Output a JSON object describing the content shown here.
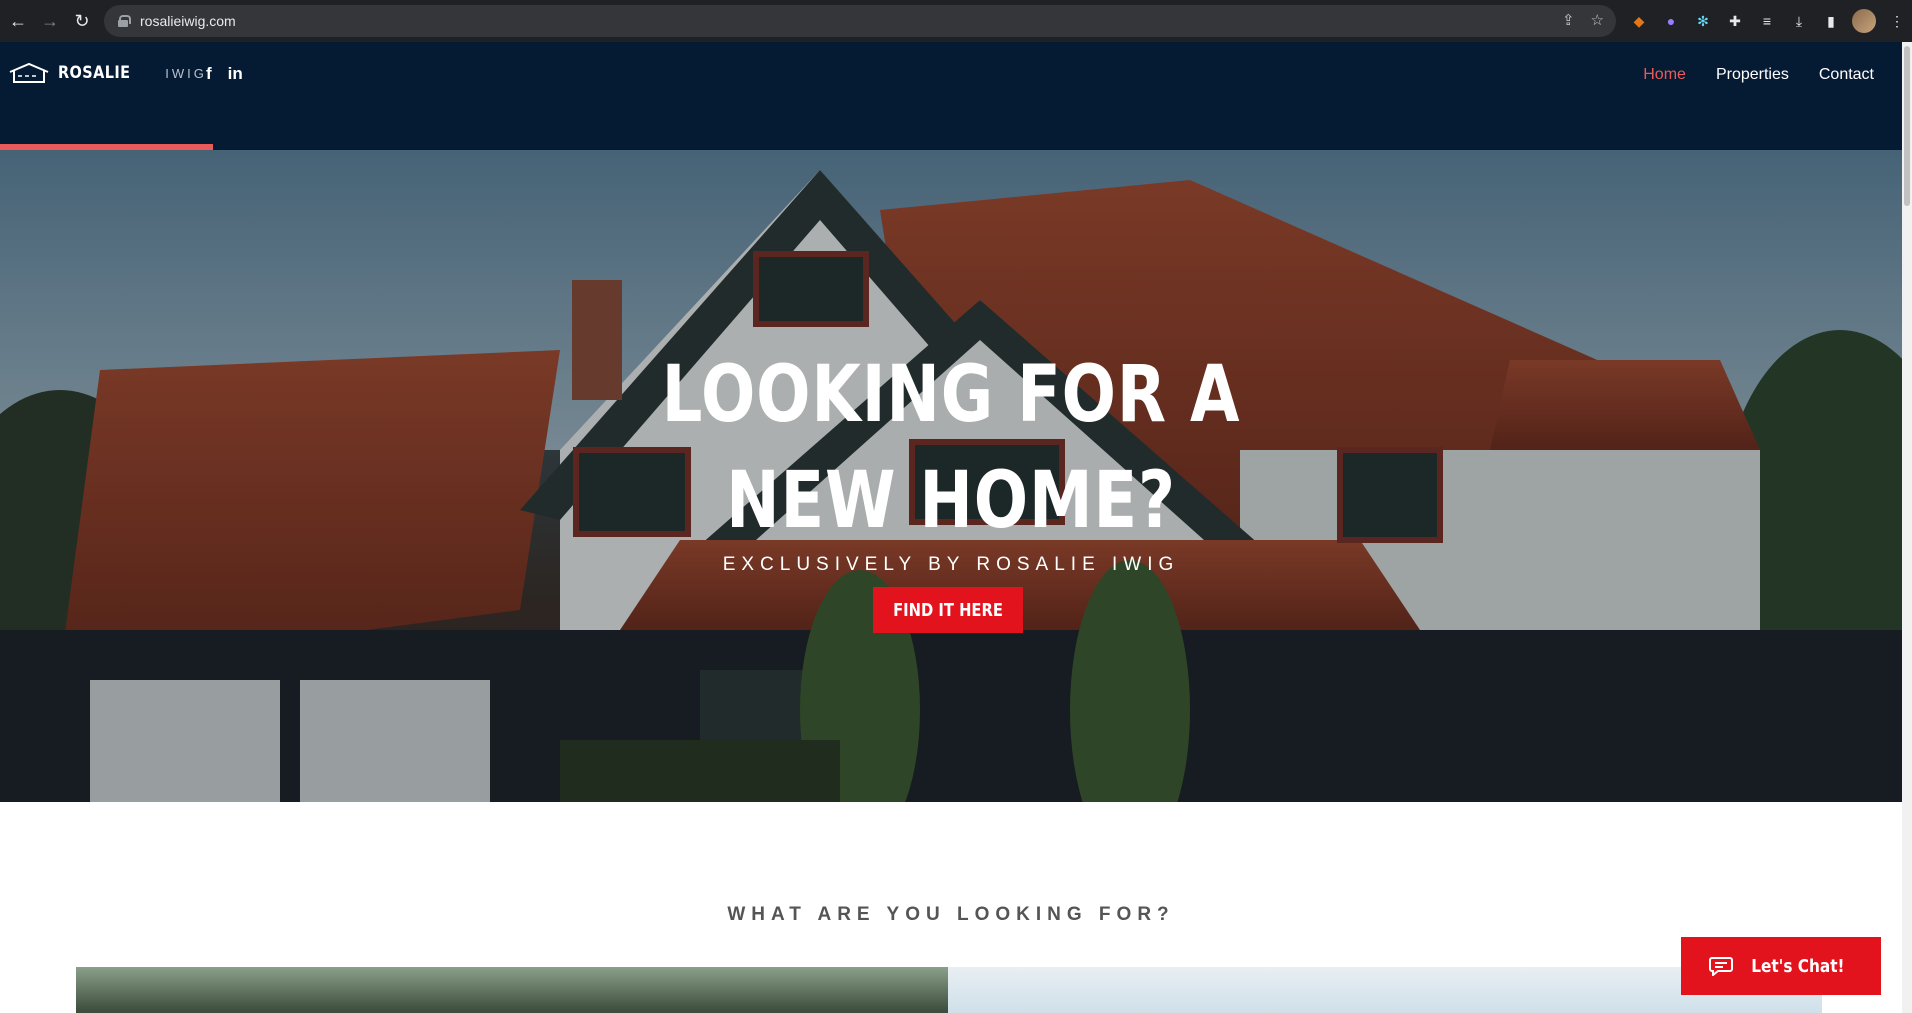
{
  "browser": {
    "url": "rosalieiwig.com",
    "nav": {
      "back": "←",
      "forward": "→",
      "reload": "↻"
    },
    "icons": [
      "share-icon",
      "star-icon",
      "fox-extension-icon",
      "purple-extension-icon",
      "react-extension-icon",
      "puzzle-extensions-icon",
      "reading-list-icon",
      "download-icon",
      "side-panel-icon",
      "profile-avatar",
      "kebab-menu-icon"
    ]
  },
  "header": {
    "logo_name": "ROSALIE",
    "logo_sub": "IWIG",
    "social": {
      "facebook": "f",
      "linkedin": "in"
    },
    "nav": [
      {
        "label": "Home",
        "active": true
      },
      {
        "label": "Properties",
        "active": false
      },
      {
        "label": "Contact",
        "active": false
      }
    ],
    "progress_fraction": 0.112
  },
  "hero": {
    "title_line1": "LOOKING FOR A",
    "title_line2": "NEW HOME?",
    "subtitle": "EXCLUSIVELY BY ROSALIE IWIG",
    "cta": "FIND IT HERE"
  },
  "section": {
    "title": "WHAT ARE YOU LOOKING FOR?"
  },
  "chat": {
    "label": "Let's Chat!"
  },
  "colors": {
    "header_bg": "#051a33",
    "accent": "#ea5a5a",
    "cta_red": "#e3131e"
  }
}
